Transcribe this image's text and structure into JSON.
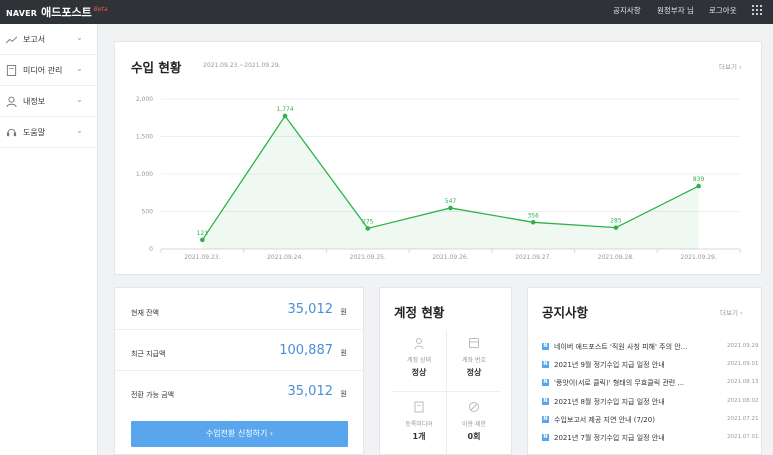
{
  "header": {
    "brand_naver": "NAVER",
    "brand_title": "애드포스트",
    "brand_beta": "Beta",
    "nav": [
      "공지사항",
      "원정부자 님",
      "로그아웃"
    ]
  },
  "sidebar": {
    "items": [
      {
        "label": "보고서",
        "icon": "chart-line-icon"
      },
      {
        "label": "미디어 관리",
        "icon": "document-icon"
      },
      {
        "label": "내정보",
        "icon": "user-icon"
      },
      {
        "label": "도움말",
        "icon": "headset-icon"
      }
    ]
  },
  "income": {
    "title": "수입 현황",
    "date_range": "2021.09.23.~2021.09.29.",
    "more": "더보기  ›"
  },
  "chart_data": {
    "type": "area",
    "categories": [
      "2021.09.23.",
      "2021.09.24.",
      "2021.09.25.",
      "2021.09.26.",
      "2021.09.27.",
      "2021.09.28.",
      "2021.09.29."
    ],
    "values": [
      121,
      1774,
      275,
      547,
      356,
      285,
      839
    ],
    "value_labels": [
      "121",
      "1,774",
      "275",
      "547",
      "356",
      "285",
      "839"
    ],
    "y_ticks": [
      "0",
      "500",
      "1,000",
      "1,500",
      "2,000"
    ],
    "ylim": [
      0,
      2000
    ],
    "color": "#2db34a",
    "grid": true
  },
  "balance": {
    "rows": [
      {
        "label": "현재 잔액",
        "value": "35,012",
        "unit": "원"
      },
      {
        "label": "최근 지급액",
        "value": "100,887",
        "unit": "원"
      },
      {
        "label": "전환 가능 금액",
        "value": "35,012",
        "unit": "원"
      }
    ],
    "button": "수입전환 신청하기  ›"
  },
  "account": {
    "title": "계정 현황",
    "cells": [
      {
        "label": "계정 상태",
        "value": "정상",
        "icon": "person-icon"
      },
      {
        "label": "계좌 번호",
        "value": "정상",
        "icon": "card-icon"
      },
      {
        "label": "등록미디어",
        "value": "1개",
        "icon": "media-icon"
      },
      {
        "label": "이용 제한",
        "value": "0회",
        "icon": "prohibited-icon"
      }
    ]
  },
  "notices": {
    "title": "공지사항",
    "more": "더보기  ›",
    "items": [
      {
        "icon": "N",
        "text": "네이버 애드포스트 '직원 사칭 피해' 주의 안...",
        "date": "2021.09.29"
      },
      {
        "icon": "N",
        "text": "2021년 9월 정기수입 지급 일정 안내",
        "date": "2021.09.01"
      },
      {
        "icon": "N",
        "text": "'풍앗이(서로 클릭)' 형태의 무효클릭 관련 ...",
        "date": "2021.08.13"
      },
      {
        "icon": "N",
        "text": "2021년 8월 정기수입 지급 일정 안내",
        "date": "2021.08.02"
      },
      {
        "icon": "N",
        "text": "수입보고서 제공 지연 안내 (7/20)",
        "date": "2021.07.21"
      },
      {
        "icon": "N",
        "text": "2021년 7월 정기수입 지급 일정 안내",
        "date": "2021.07.01"
      }
    ]
  }
}
